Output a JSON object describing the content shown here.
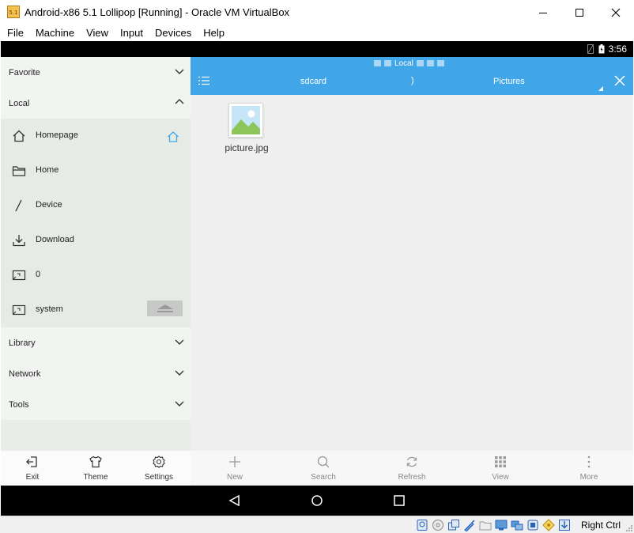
{
  "window": {
    "title": "Android-x86 5.1 Lollipop [Running] - Oracle VM VirtualBox",
    "app_icon_text": "5.1",
    "controls": [
      "minimize-icon",
      "maximize-icon",
      "close-icon"
    ]
  },
  "menubar": {
    "items": [
      "File",
      "Machine",
      "View",
      "Input",
      "Devices",
      "Help"
    ]
  },
  "android": {
    "status_bar": {
      "time": "3:56",
      "icons": [
        "no-sim-icon",
        "battery-icon"
      ]
    },
    "drawer": {
      "sections": {
        "favorite": "Favorite",
        "local": "Local",
        "library": "Library",
        "network": "Network",
        "tools": "Tools"
      },
      "local_items": [
        {
          "label": "Homepage",
          "icon": "home-icon"
        },
        {
          "label": "Home",
          "icon": "folder-icon"
        },
        {
          "label": "Device",
          "icon": "slash-icon"
        },
        {
          "label": "Download",
          "icon": "download-icon"
        },
        {
          "label": "0",
          "icon": "storage-icon"
        },
        {
          "label": "system",
          "icon": "storage-icon"
        }
      ],
      "toolbar": {
        "exit": "Exit",
        "theme": "Theme",
        "settings": "Settings"
      }
    },
    "pane": {
      "mini_crumb": "Local",
      "path": {
        "first": "sdcard",
        "separator": ")",
        "current": "Pictures"
      },
      "files": [
        {
          "name": "picture.jpg",
          "icon": "image-icon"
        }
      ],
      "toolbar": {
        "new": "New",
        "search": "Search",
        "refresh": "Refresh",
        "view": "View",
        "more": "More"
      }
    },
    "nav": [
      "back-icon",
      "home-circle-icon",
      "recents-icon"
    ]
  },
  "vbox_status": {
    "host_key": "Right Ctrl",
    "accent": "#2a62b8"
  },
  "colors": {
    "accent_blue": "#41a6e8",
    "drawer_bg": "#f1f4f1",
    "local_bg": "#e6ebe6"
  }
}
